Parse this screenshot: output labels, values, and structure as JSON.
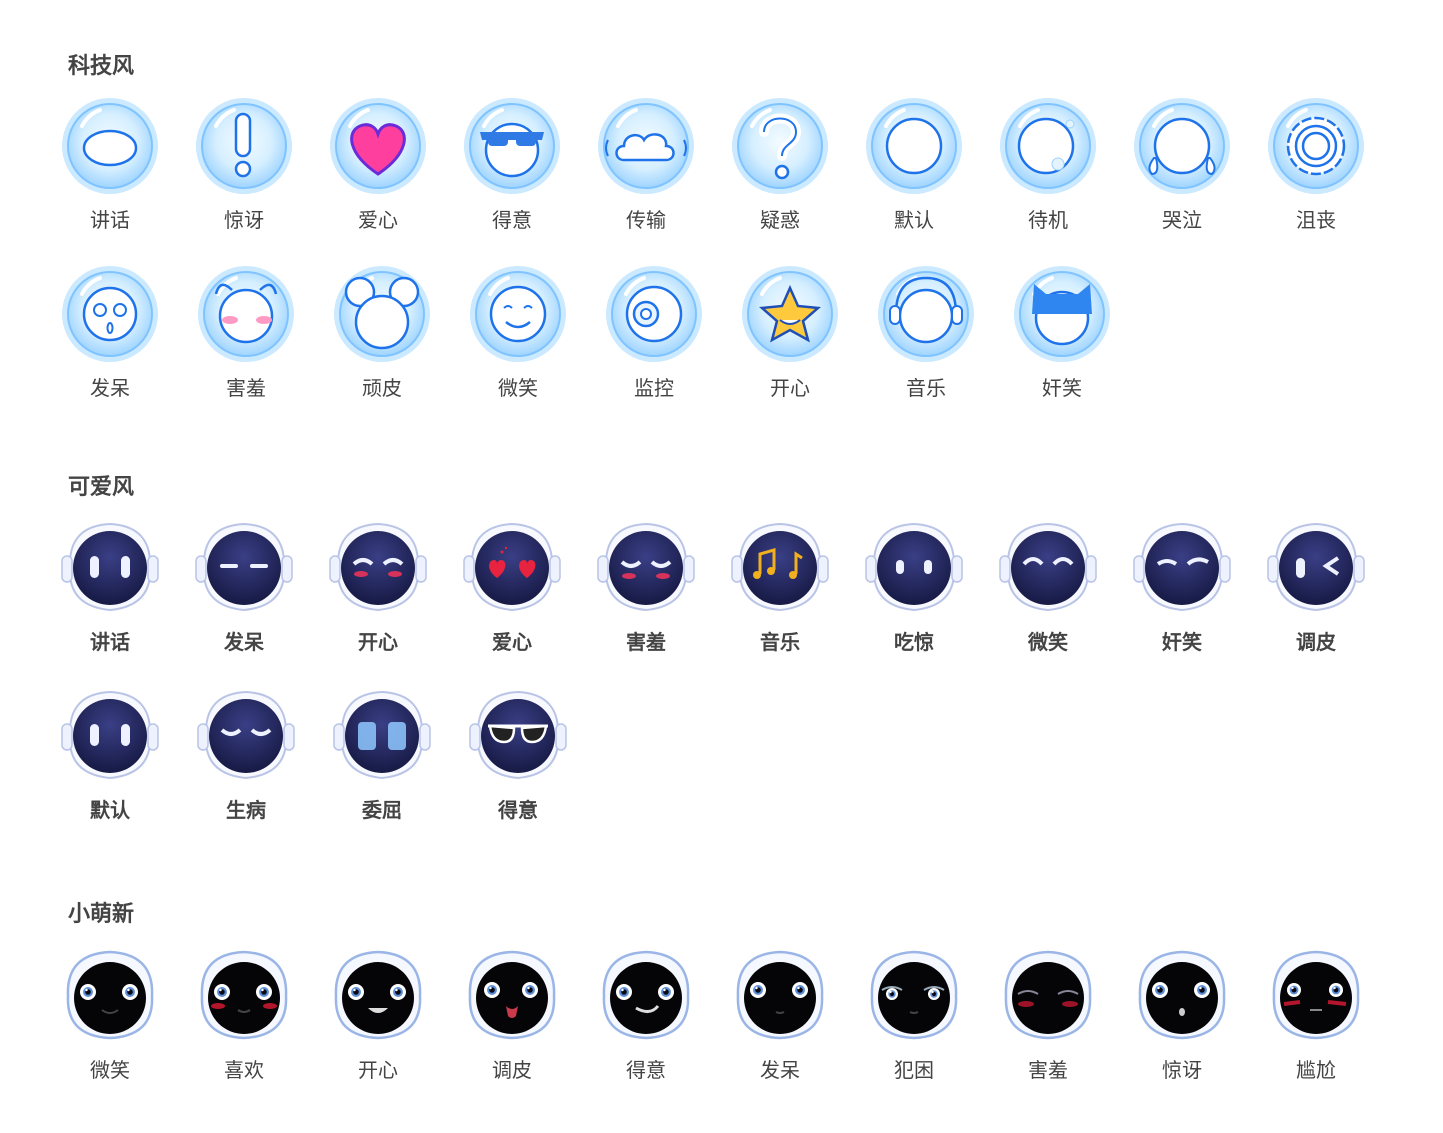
{
  "sections": [
    {
      "title": "科技风",
      "style": "tech",
      "items": [
        {
          "label": "讲话",
          "icon": "oval-mouth-icon"
        },
        {
          "label": "惊讶",
          "icon": "exclamation-icon"
        },
        {
          "label": "爱心",
          "icon": "heart-icon"
        },
        {
          "label": "得意",
          "icon": "sunglasses-icon"
        },
        {
          "label": "传输",
          "icon": "cloud-icon"
        },
        {
          "label": "疑惑",
          "icon": "question-icon"
        },
        {
          "label": "默认",
          "icon": "circle-icon"
        },
        {
          "label": "待机",
          "icon": "bubble-icon"
        },
        {
          "label": "哭泣",
          "icon": "tears-icon"
        },
        {
          "label": "沮丧",
          "icon": "gear-icon"
        },
        {
          "label": "发呆",
          "icon": "dazed-face-icon"
        },
        {
          "label": "害羞",
          "icon": "shy-face-icon"
        },
        {
          "label": "顽皮",
          "icon": "mouse-ears-icon"
        },
        {
          "label": "微笑",
          "icon": "smile-icon"
        },
        {
          "label": "监控",
          "icon": "camera-lens-icon"
        },
        {
          "label": "开心",
          "icon": "star-icon"
        },
        {
          "label": "音乐",
          "icon": "headphones-icon"
        },
        {
          "label": "奸笑",
          "icon": "cat-hat-icon"
        }
      ]
    },
    {
      "title": "可爱风",
      "style": "cute",
      "items": [
        {
          "label": "讲话",
          "icon": "talk-eyes-icon"
        },
        {
          "label": "发呆",
          "icon": "blank-eyes-icon"
        },
        {
          "label": "开心",
          "icon": "happy-eyes-icon"
        },
        {
          "label": "爱心",
          "icon": "heart-eyes-icon"
        },
        {
          "label": "害羞",
          "icon": "shy-eyes-icon"
        },
        {
          "label": "音乐",
          "icon": "music-notes-icon"
        },
        {
          "label": "吃惊",
          "icon": "surprised-eyes-icon"
        },
        {
          "label": "微笑",
          "icon": "smile-eyes-icon"
        },
        {
          "label": "奸笑",
          "icon": "smirk-eyes-icon"
        },
        {
          "label": "调皮",
          "icon": "wink-eyes-icon"
        },
        {
          "label": "默认",
          "icon": "default-eyes-icon"
        },
        {
          "label": "生病",
          "icon": "sick-eyes-icon"
        },
        {
          "label": "委屈",
          "icon": "sad-eyes-icon"
        },
        {
          "label": "得意",
          "icon": "cool-sunglasses-icon"
        }
      ]
    },
    {
      "title": "小萌新",
      "style": "baby",
      "items": [
        {
          "label": "微笑",
          "icon": "baby-smile-icon"
        },
        {
          "label": "喜欢",
          "icon": "baby-like-icon"
        },
        {
          "label": "开心",
          "icon": "baby-happy-icon"
        },
        {
          "label": "调皮",
          "icon": "baby-tongue-icon"
        },
        {
          "label": "得意",
          "icon": "baby-proud-icon"
        },
        {
          "label": "发呆",
          "icon": "baby-daze-icon"
        },
        {
          "label": "犯困",
          "icon": "baby-sleepy-icon"
        },
        {
          "label": "害羞",
          "icon": "baby-shy-icon"
        },
        {
          "label": "惊讶",
          "icon": "baby-surprised-icon"
        },
        {
          "label": "尴尬",
          "icon": "baby-awkward-icon"
        }
      ]
    }
  ],
  "colors": {
    "tech_blue": "#1e6fe8",
    "tech_glow": "#bfe3ff",
    "cute_face": "#1e2156",
    "baby_face": "#050507"
  }
}
